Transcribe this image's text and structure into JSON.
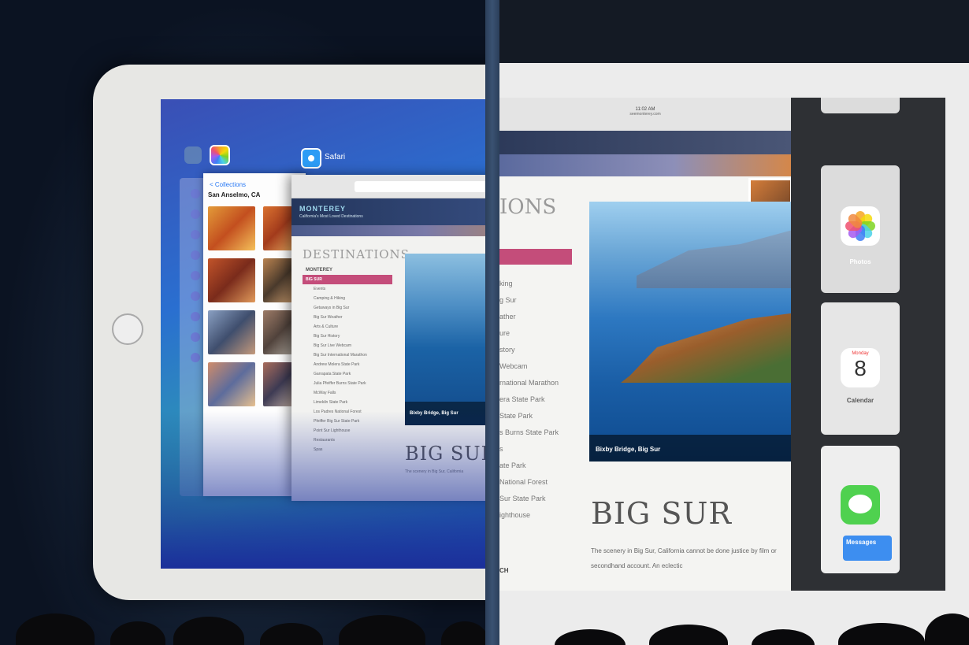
{
  "left_view": {
    "switcher_apps": [
      "Photos",
      "Safari"
    ],
    "safari_app_label": "Safari",
    "photos_card": {
      "back_label": "< Collections",
      "location_title": "San Anselmo, CA"
    },
    "safari_card": {
      "site_logo": "MONTEREY",
      "site_subtitle": "California's Most Loved Destinations",
      "destinations_title": "DESTINATIONS",
      "city": "MONTEREY",
      "active_item": "BIG SUR",
      "nav_items": [
        "Events",
        "Camping & Hiking",
        "Getaways in Big Sur",
        "Big Sur Weather",
        "Arts & Culture",
        "Big Sur History",
        "Big Sur Live Webcam",
        "Big Sur International Marathon",
        "Andrew Molera State Park",
        "Garrapata State Park",
        "Julia Pfeiffer Burns State Park",
        "McWay Falls",
        "Limekiln State Park",
        "Los Padres National Forest",
        "Pfeiffer Big Sur State Park",
        "Point Sur Lighthouse",
        "Restaurants",
        "Spas"
      ],
      "photo_caption": "Bixby Bridge, Big Sur",
      "heading": "BIG SUR",
      "body_text": "The scenery in Big Sur, California"
    }
  },
  "right_view": {
    "status_time": "11:02 AM",
    "status_url": "seemonterey.com",
    "destinations_partial": "IONS",
    "nav_items_partial": [
      "king",
      "g Sur",
      "ather",
      "ure",
      "story",
      "Webcam",
      "rnational Marathon",
      "era State Park",
      "State Park",
      "s Burns State Park",
      "s",
      "ate Park",
      "National Forest",
      "Sur State Park",
      "ighthouse"
    ],
    "photo_caption": "Bixby Bridge, Big Sur",
    "heading": "BIG SUR",
    "body_text": "The scenery in Big Sur, California cannot be done justice by film or secondhand account. An eclectic",
    "section_partial": "CH",
    "switcher": {
      "photos_label": "Photos",
      "calendar_day": "Monday",
      "calendar_date": "8",
      "calendar_label": "Calendar",
      "messages_label": "Messages"
    }
  },
  "colors": {
    "accent_pink": "#c44d7a",
    "switcher_bg": "#2e3034"
  }
}
